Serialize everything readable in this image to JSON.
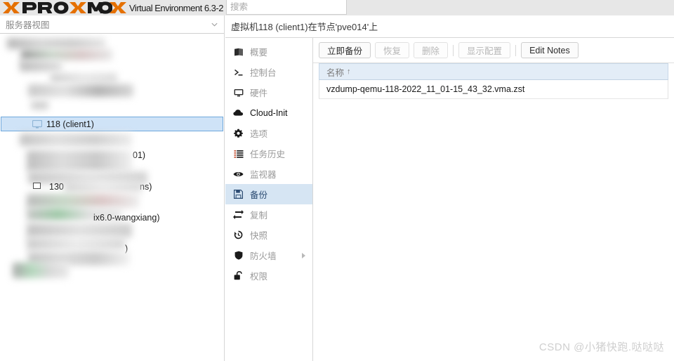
{
  "topbar": {
    "logo_text": "PROXMOX",
    "product_name": "Virtual Environment 6.3-2",
    "search_placeholder": "搜索",
    "search_value": ""
  },
  "sidebar": {
    "view_selector_label": "服务器视图",
    "selected_node": "118 (client1)",
    "visible_text_fragments": [
      "01)",
      "130",
      "ns)",
      "ix6.0-wangxiang)",
      ")"
    ]
  },
  "page": {
    "title": "虚拟机118 (client1)在节点'pve014'上"
  },
  "nav": {
    "items": [
      {
        "label": "概要",
        "icon": "book-icon",
        "selected": false,
        "dark": false,
        "submenu": false
      },
      {
        "label": "控制台",
        "icon": "terminal-icon",
        "selected": false,
        "dark": false,
        "submenu": false
      },
      {
        "label": "硬件",
        "icon": "monitor-icon",
        "selected": false,
        "dark": false,
        "submenu": false
      },
      {
        "label": "Cloud-Init",
        "icon": "cloud-icon",
        "selected": false,
        "dark": true,
        "submenu": false
      },
      {
        "label": "选项",
        "icon": "gear-icon",
        "selected": false,
        "dark": false,
        "submenu": false
      },
      {
        "label": "任务历史",
        "icon": "list-icon",
        "selected": false,
        "dark": false,
        "submenu": false
      },
      {
        "label": "监视器",
        "icon": "eye-icon",
        "selected": false,
        "dark": false,
        "submenu": false
      },
      {
        "label": "备份",
        "icon": "floppy-disk-icon",
        "selected": true,
        "dark": false,
        "submenu": false
      },
      {
        "label": "复制",
        "icon": "sync-arrows-icon",
        "selected": false,
        "dark": false,
        "submenu": false
      },
      {
        "label": "快照",
        "icon": "clock-undo-icon",
        "selected": false,
        "dark": false,
        "submenu": false
      },
      {
        "label": "防火墙",
        "icon": "shield-icon",
        "selected": false,
        "dark": false,
        "submenu": true
      },
      {
        "label": "权限",
        "icon": "unlock-icon",
        "selected": false,
        "dark": false,
        "submenu": false
      }
    ]
  },
  "toolbar": {
    "backup_now_label": "立即备份",
    "restore_label": "恢复",
    "delete_label": "删除",
    "show_config_label": "显示配置",
    "edit_notes_label": "Edit Notes"
  },
  "grid": {
    "column_name": "名称",
    "sort_indicator": "↑",
    "rows": [
      {
        "name": "vzdump-qemu-118-2022_11_01-15_43_32.vma.zst"
      }
    ]
  },
  "watermark": {
    "text": "CSDN @小猪快跑.哒哒哒"
  },
  "colors": {
    "brand_orange": "#E57000",
    "selection_blue": "#d6e5f3",
    "tree_selection_blue": "#cfe3f7",
    "grid_header_blue": "#e3edf7",
    "topbar_gray": "#e7e7e7"
  }
}
